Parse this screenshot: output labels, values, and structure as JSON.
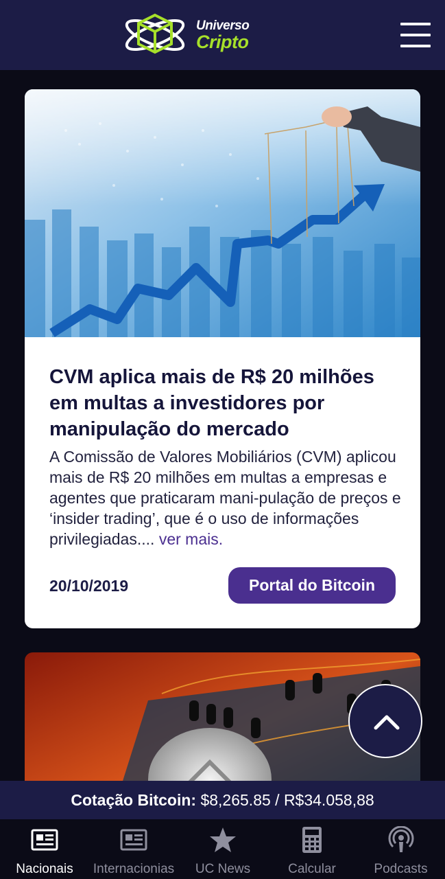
{
  "header": {
    "logo_line1": "Universo",
    "logo_line2": "Cripto",
    "menu_icon": "hamburger-menu-icon"
  },
  "articles": [
    {
      "title": "CVM aplica mais de R$ 20 milhões em multas a investidores por manipulação do mercado",
      "excerpt": "A Comissão de Valores Mobiliários (CVM) aplicou mais de R$ 20 milhões em multas a empresas e agentes que praticaram mani-pulação de preços e ‘insider trading’, que é o uso de informações privilegiadas....",
      "read_more": "ver mais.",
      "date": "20/10/2019",
      "source": "Portal do Bitcoin"
    }
  ],
  "ticker": {
    "label": "Cotação Bitcoin:",
    "value": "$8,265.85 / R$34.058,88"
  },
  "nav": {
    "items": [
      {
        "label": "Nacionais",
        "icon": "newspaper-icon",
        "active": true
      },
      {
        "label": "Internacionias",
        "icon": "newspaper-icon",
        "active": false
      },
      {
        "label": "UC News",
        "icon": "star-icon",
        "active": false
      },
      {
        "label": "Calcular",
        "icon": "calculator-icon",
        "active": false
      },
      {
        "label": "Podcasts",
        "icon": "podcast-icon",
        "active": false
      }
    ]
  },
  "colors": {
    "header_bg": "#1c1c46",
    "page_bg": "#0b0b17",
    "accent_purple": "#4a2f8f",
    "logo_green": "#a7e02a"
  }
}
